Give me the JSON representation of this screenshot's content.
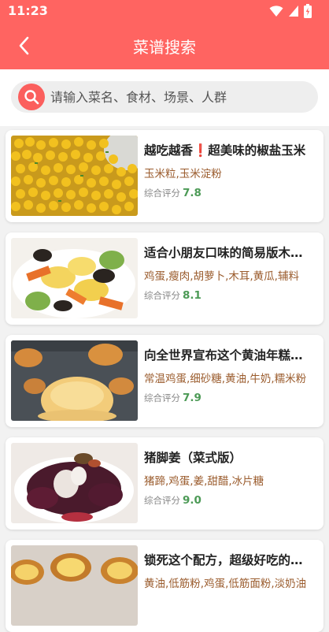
{
  "status_bar": {
    "time": "11:23"
  },
  "header": {
    "title": "菜谱搜索"
  },
  "search": {
    "placeholder": "请输入菜名、食材、场景、人群"
  },
  "recipes": [
    {
      "title": "越吃越香❗️超美味的椒盐玉米",
      "ingredients": "玉米粒,玉米淀粉",
      "score_label": "综合评分",
      "score": "7.8",
      "image": "corn-dish"
    },
    {
      "title": "适合小朋友口味的简易版木须肉",
      "ingredients": "鸡蛋,瘦肉,胡萝卜,木耳,黄瓜,辅料",
      "score_label": "综合评分",
      "score": "8.1",
      "image": "egg-stir-fry"
    },
    {
      "title": "向全世界宣布这个黄油年糕泡芙",
      "ingredients": "常温鸡蛋,细砂糖,黄油,牛奶,糯米粉",
      "score_label": "综合评分",
      "score": "7.9",
      "image": "puff-pastry"
    },
    {
      "title": "猪脚姜（菜式版）",
      "ingredients": "猪蹄,鸡蛋,姜,甜醋,冰片糖",
      "score_label": "综合评分",
      "score": "9.0",
      "image": "pork-trotter"
    },
    {
      "title": "锁死这个配方，超级好吃的蛋挞",
      "ingredients": "黄油,低筋粉,鸡蛋,低筋面粉,淡奶油",
      "score_label": "综合评分",
      "score": "",
      "image": "egg-tart"
    }
  ]
}
